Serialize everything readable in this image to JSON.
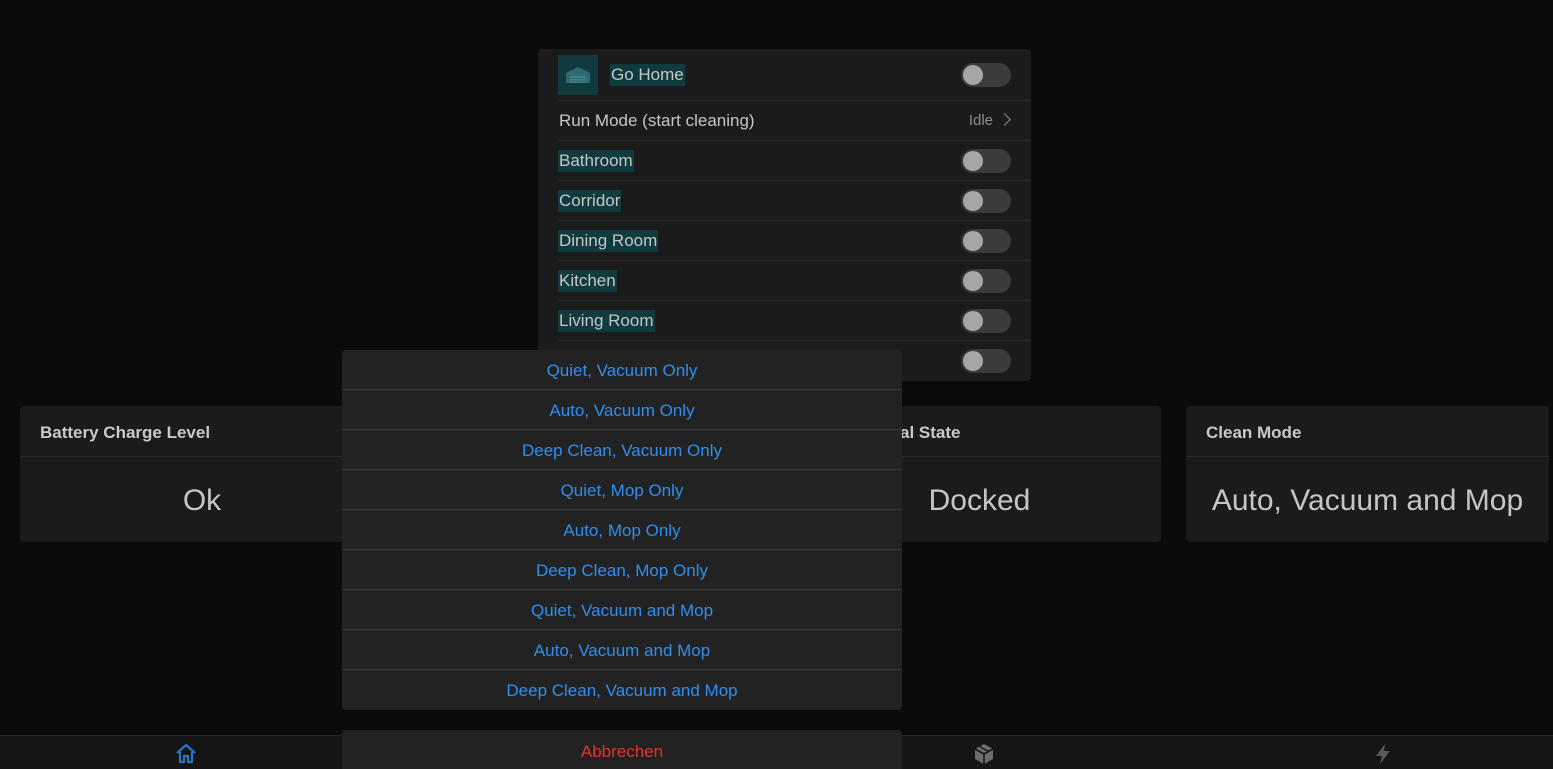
{
  "device": {
    "go_home_label": "Go Home",
    "run_mode_label": "Run Mode (start cleaning)",
    "run_mode_value": "Idle",
    "rooms": [
      {
        "label": "Bathroom"
      },
      {
        "label": "Corridor"
      },
      {
        "label": "Dining Room"
      },
      {
        "label": "Kitchen"
      },
      {
        "label": "Living Room"
      }
    ]
  },
  "cards": {
    "battery": {
      "title": "Battery Charge Level",
      "value": "Ok"
    },
    "operational": {
      "title": "al State",
      "value": "Docked"
    },
    "clean_mode": {
      "title": "Clean Mode",
      "value": "Auto, Vacuum and Mop"
    }
  },
  "sheet": {
    "options": [
      "Quiet, Vacuum Only",
      "Auto, Vacuum Only",
      "Deep Clean, Vacuum Only",
      "Quiet, Mop Only",
      "Auto, Mop Only",
      "Deep Clean, Mop Only",
      "Quiet, Vacuum and Mop",
      "Auto, Vacuum and Mop",
      "Deep Clean, Vacuum and Mop"
    ],
    "cancel_label": "Abbrechen"
  },
  "nav": {
    "icons": [
      "home-icon",
      "scenes-icon",
      "cube-icon",
      "automation-icon"
    ]
  },
  "colors": {
    "accent_blue": "#2f8ef0",
    "cancel_red": "#e8312b",
    "highlight": "#0f3b3e",
    "nav_active": "#2a74c4"
  }
}
